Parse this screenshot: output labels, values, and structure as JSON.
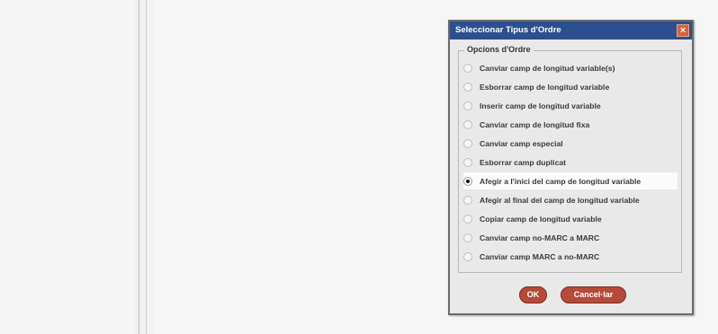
{
  "dialog": {
    "title": "Seleccionar Tipus d'Ordre",
    "close_glyph": "×",
    "group_label": "Opcions d'Ordre",
    "options": [
      {
        "label": "Canviar camp de longitud variable(s)",
        "checked": false
      },
      {
        "label": "Esborrar camp de longitud variable",
        "checked": false
      },
      {
        "label": "Inserir camp de longitud variable",
        "checked": false
      },
      {
        "label": "Canviar camp de longitud fixa",
        "checked": false
      },
      {
        "label": "Canviar camp especial",
        "checked": false
      },
      {
        "label": "Esborrar camp duplicat",
        "checked": false
      },
      {
        "label": "Afegir a l'inici del camp de longitud variable",
        "checked": true
      },
      {
        "label": "Afegir al final del camp de longitud variable",
        "checked": false
      },
      {
        "label": "Copiar camp de longitud variable",
        "checked": false
      },
      {
        "label": "Canviar camp no-MARC a MARC",
        "checked": false
      },
      {
        "label": "Canviar camp MARC a no-MARC",
        "checked": false
      }
    ],
    "ok_label": "OK",
    "cancel_label": "Cancel·lar"
  },
  "colors": {
    "titlebar": "#2c4f8f",
    "button": "#b54a3a",
    "close_button": "#d8623a"
  }
}
